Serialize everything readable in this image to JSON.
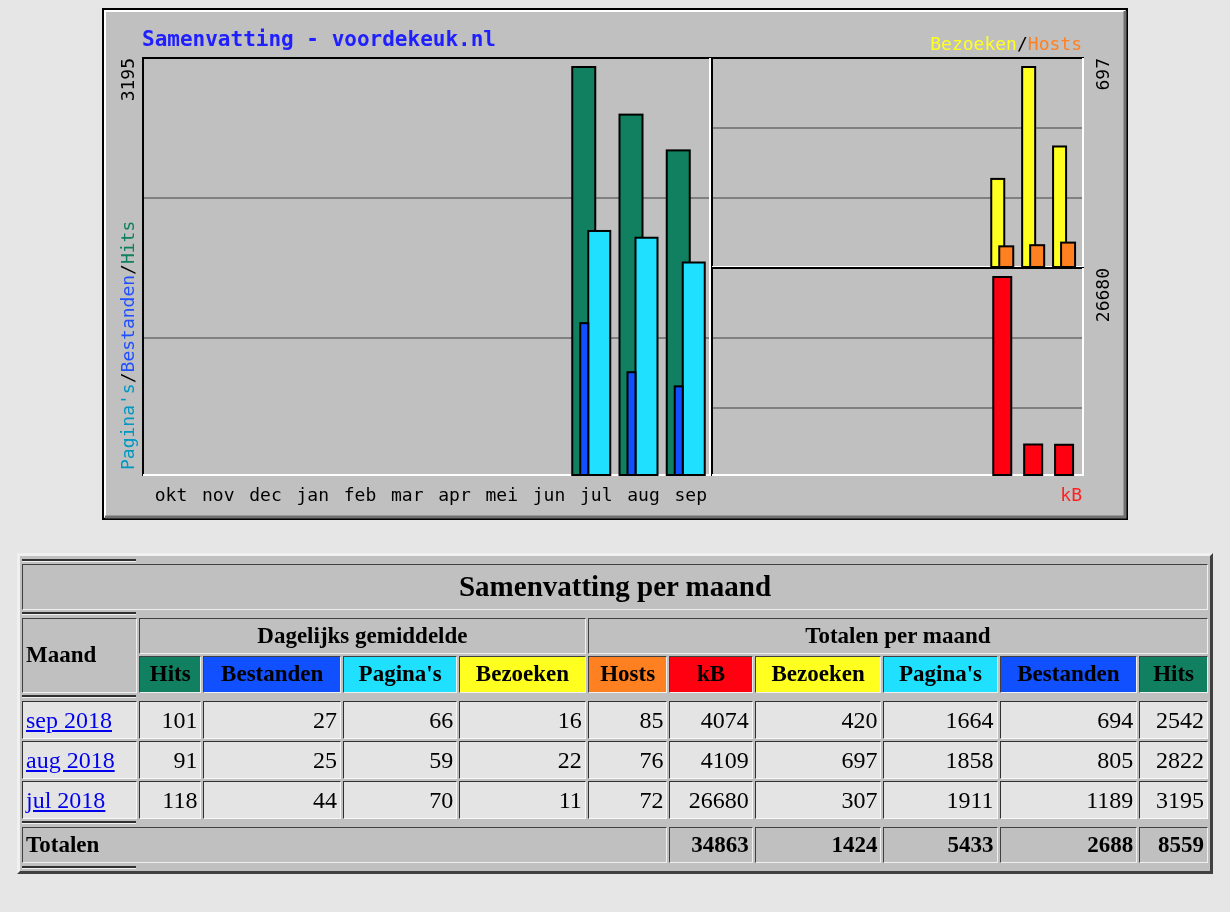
{
  "chart": {
    "title": "Samenvatting - voordekeuk.nl",
    "legend_top": [
      {
        "label": "Bezoeken",
        "color": "#ffff20"
      },
      {
        "label": "/",
        "color": "#000000"
      },
      {
        "label": "Hosts",
        "color": "#ff8020"
      }
    ],
    "legend_left": [
      {
        "label": "Pagina's",
        "color": "#0098c0"
      },
      {
        "label": "/",
        "color": "#000000"
      },
      {
        "label": "Bestanden",
        "color": "#2050ff"
      },
      {
        "label": "/",
        "color": "#000000"
      },
      {
        "label": "Hits",
        "color": "#108060"
      }
    ],
    "left_max": "3195",
    "right_top_max": "697",
    "right_bottom_max": "26680",
    "months": [
      "okt",
      "nov",
      "dec",
      "jan",
      "feb",
      "mar",
      "apr",
      "mei",
      "jun",
      "jul",
      "aug",
      "sep"
    ],
    "unit": {
      "label": "kB",
      "color": "#ff2020"
    }
  },
  "table": {
    "title": "Samenvatting per maand",
    "month_header": "Maand",
    "daily_header": "Dagelijks gemiddelde",
    "totals_header": "Totalen per maand",
    "daily_columns": [
      {
        "label": "Hits",
        "color": "#108060"
      },
      {
        "label": "Bestanden",
        "color": "#1050ff"
      },
      {
        "label": "Pagina's",
        "color": "#20e0ff"
      },
      {
        "label": "Bezoeken",
        "color": "#ffff20"
      }
    ],
    "total_columns": [
      {
        "label": "Hosts",
        "kind": "hosts",
        "color": "#ff8020"
      },
      {
        "label": "kB",
        "kind": "kb",
        "color": "#ff0010"
      },
      {
        "label": "Bezoeken",
        "kind": "visits",
        "color": "#ffff20"
      },
      {
        "label": "Pagina's",
        "kind": "pages",
        "color": "#20e0ff"
      },
      {
        "label": "Bestanden",
        "kind": "files",
        "color": "#1050ff"
      },
      {
        "label": "Hits",
        "kind": "hits",
        "color": "#108060"
      }
    ],
    "rows": [
      {
        "month": "sep 2018",
        "daily": [
          "101",
          "27",
          "66",
          "16"
        ],
        "totals": [
          "85",
          "4074",
          "420",
          "1664",
          "694",
          "2542"
        ]
      },
      {
        "month": "aug 2018",
        "daily": [
          "91",
          "25",
          "59",
          "22"
        ],
        "totals": [
          "76",
          "4109",
          "697",
          "1858",
          "805",
          "2822"
        ]
      },
      {
        "month": "jul 2018",
        "daily": [
          "118",
          "44",
          "70",
          "11"
        ],
        "totals": [
          "72",
          "26680",
          "307",
          "1911",
          "1189",
          "3195"
        ]
      }
    ],
    "totals_row": {
      "label": "Totalen",
      "values": [
        "34863",
        "1424",
        "5433",
        "2688",
        "8559"
      ]
    }
  }
}
